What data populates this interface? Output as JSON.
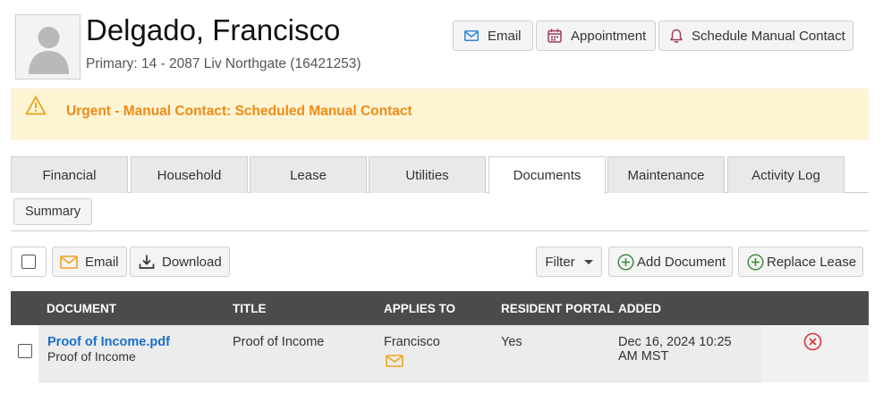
{
  "resident": {
    "name": "Delgado, Francisco",
    "primary": "Primary: 14 - 2087 Liv Northgate (16421253)"
  },
  "header_actions": {
    "email": "Email",
    "appointment": "Appointment",
    "schedule_manual_contact": "Schedule Manual Contact"
  },
  "alert": {
    "text": "Urgent - Manual Contact: Scheduled Manual Contact",
    "color": "#ef8b16"
  },
  "tabs": [
    {
      "label": "Financial"
    },
    {
      "label": "Household"
    },
    {
      "label": "Lease"
    },
    {
      "label": "Utilities"
    },
    {
      "label": "Documents",
      "active": true
    },
    {
      "label": "Maintenance"
    },
    {
      "label": "Activity Log"
    }
  ],
  "subtabs": {
    "summary": "Summary"
  },
  "toolbar": {
    "email": "Email",
    "download": "Download",
    "filter": "Filter",
    "add_document": "Add Document",
    "replace_lease": "Replace Lease"
  },
  "table": {
    "columns": [
      "DOCUMENT",
      "TITLE",
      "APPLIES TO",
      "RESIDENT PORTAL",
      "ADDED"
    ],
    "rows": [
      {
        "file": "Proof of Income.pdf",
        "file_desc": "Proof of Income",
        "title": "Proof of Income",
        "applies_to": "Francisco",
        "resident_portal": "Yes",
        "added_line1": "Dec 16, 2024 10:25",
        "added_line2": "AM MST"
      }
    ]
  },
  "icons": [
    "avatar-placeholder",
    "envelope-icon",
    "calendar-icon",
    "bell-icon",
    "warning-icon",
    "download-icon",
    "plus-circle-icon",
    "delete-x-circle-icon"
  ]
}
